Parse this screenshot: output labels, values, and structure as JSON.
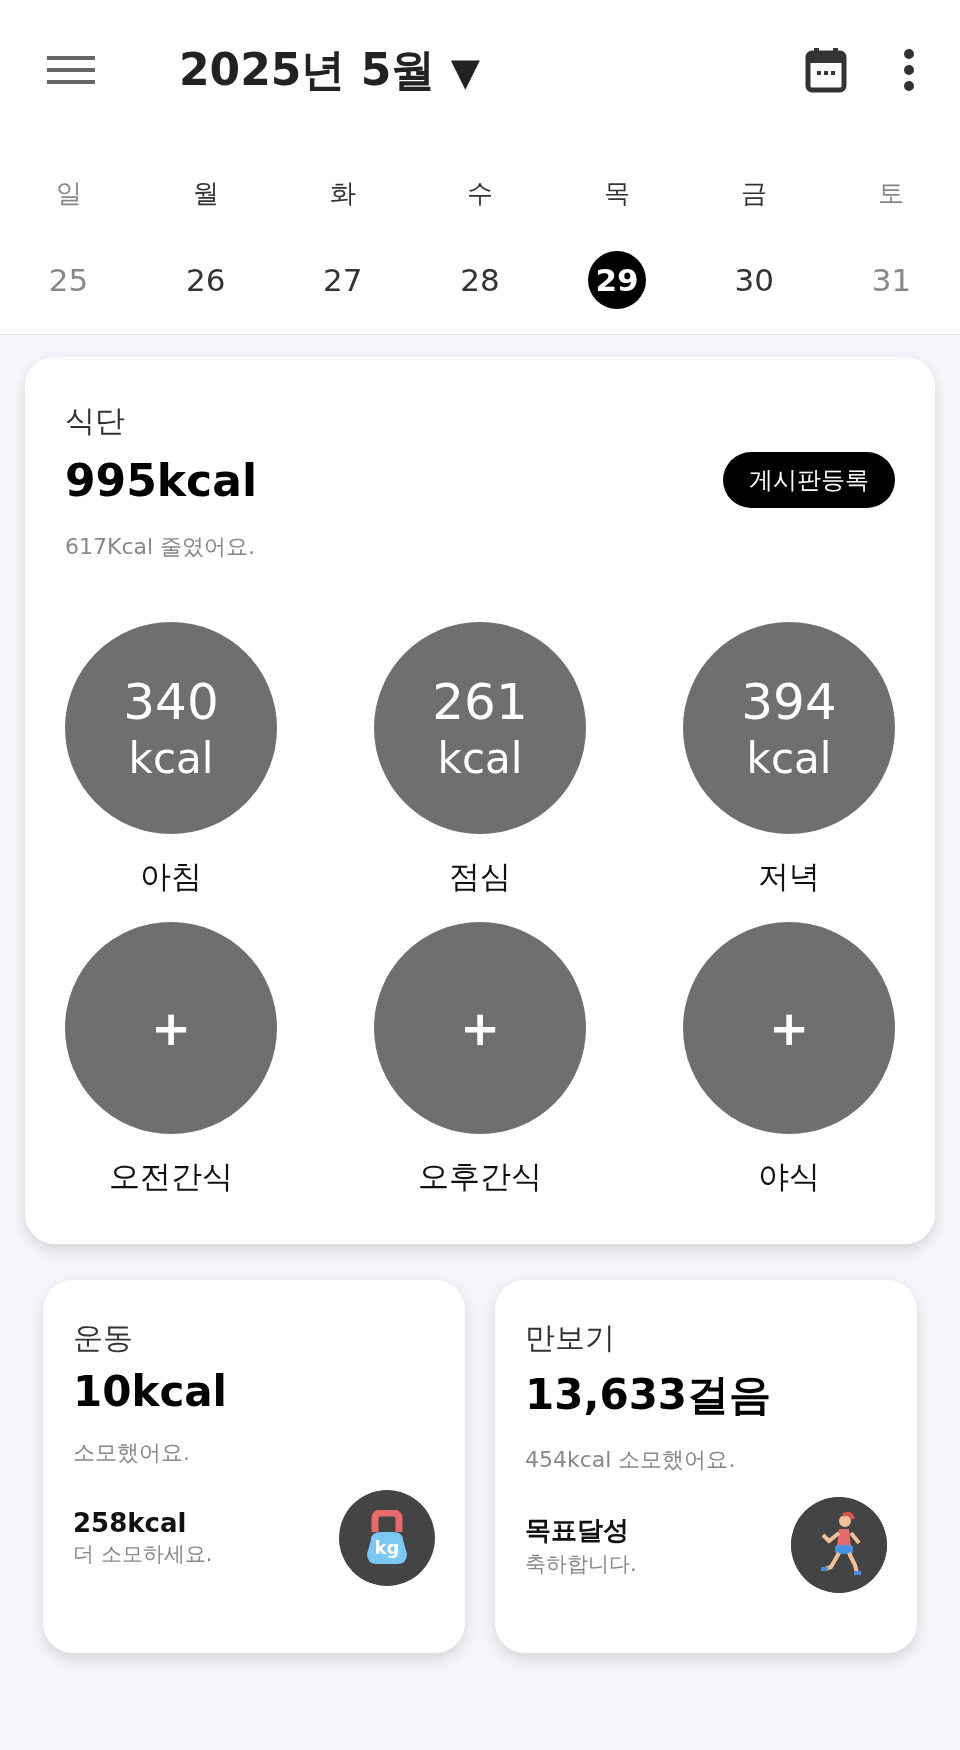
{
  "header": {
    "title": "2025년 5월",
    "dropdown_glyph": "▼"
  },
  "week": [
    {
      "weekday": "일",
      "date": "25",
      "weekend": true,
      "selected": false
    },
    {
      "weekday": "월",
      "date": "26",
      "weekend": false,
      "selected": false
    },
    {
      "weekday": "화",
      "date": "27",
      "weekend": false,
      "selected": false
    },
    {
      "weekday": "수",
      "date": "28",
      "weekend": false,
      "selected": false
    },
    {
      "weekday": "목",
      "date": "29",
      "weekend": false,
      "selected": true
    },
    {
      "weekday": "금",
      "date": "30",
      "weekend": false,
      "selected": false
    },
    {
      "weekday": "토",
      "date": "31",
      "weekend": true,
      "selected": false
    }
  ],
  "diet": {
    "title": "식단",
    "total": "995kcal",
    "button": "게시판등록",
    "note": "617Kcal 줄였어요.",
    "meals": [
      {
        "kind": "logged",
        "value": "340",
        "unit": "kcal",
        "label": "아침"
      },
      {
        "kind": "logged",
        "value": "261",
        "unit": "kcal",
        "label": "점심"
      },
      {
        "kind": "logged",
        "value": "394",
        "unit": "kcal",
        "label": "저녁"
      },
      {
        "kind": "empty",
        "value": "+",
        "label": "오전간식"
      },
      {
        "kind": "empty",
        "value": "+",
        "label": "오후간식"
      },
      {
        "kind": "empty",
        "value": "+",
        "label": "야식"
      }
    ]
  },
  "cards": [
    {
      "kind": "exercise",
      "title": "운동",
      "value": "10kcal",
      "note": "소모했어요.",
      "goal": "258kcal",
      "goal_note": "더 소모하세요.",
      "icon_text": "kg"
    },
    {
      "kind": "steps",
      "title": "만보기",
      "value": "13,633걸음",
      "note": "454kcal 소모했어요.",
      "goal": "목표달성",
      "goal_note": "축하합니다."
    }
  ]
}
